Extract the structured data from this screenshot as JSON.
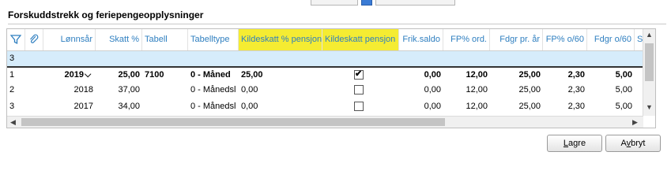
{
  "section": {
    "title": "Forskuddstrekk og feriepengeopplysninger"
  },
  "grid": {
    "columns": [
      {
        "key": "filter",
        "label": "",
        "icon": "filter-icon"
      },
      {
        "key": "attach",
        "label": "",
        "icon": "paperclip-icon"
      },
      {
        "key": "lonnsar",
        "label": "Lønnsår"
      },
      {
        "key": "skatt",
        "label": "Skatt %"
      },
      {
        "key": "tabell",
        "label": "Tabell"
      },
      {
        "key": "tabelltype",
        "label": "Tabelltype"
      },
      {
        "key": "kildeskatt_pct",
        "label": "Kildeskatt  % pensjon",
        "highlight": true
      },
      {
        "key": "kildeskatt",
        "label": "Kildeskatt pensjon",
        "highlight": true
      },
      {
        "key": "frik",
        "label": "Frik.saldo"
      },
      {
        "key": "fp_ord",
        "label": "FP% ord."
      },
      {
        "key": "fdgr_ar",
        "label": "Fdgr pr. år"
      },
      {
        "key": "fp_o60",
        "label": "FP% o/60"
      },
      {
        "key": "fdgr_o60",
        "label": "Fdgr o/60"
      },
      {
        "key": "s",
        "label": "S"
      }
    ],
    "rows": [
      {
        "num": "3",
        "new": true
      },
      {
        "num": "1",
        "lonnsar": "2019",
        "skatt": "25,00",
        "tabell": "7100",
        "tabelltype": "0 - Måned",
        "kildeskatt_pct": "25,00",
        "checked": true,
        "frik": "0,00",
        "fp_ord": "12,00",
        "fdgr_ar": "25,00",
        "fp_o60": "2,30",
        "fdgr_o60": "5,00",
        "bold": true
      },
      {
        "num": "2",
        "lonnsar": "2018",
        "skatt": "37,00",
        "tabell": "",
        "tabelltype": "0 - Månedsl",
        "kildeskatt_pct": "0,00",
        "checked": false,
        "frik": "0,00",
        "fp_ord": "12,00",
        "fdgr_ar": "25,00",
        "fp_o60": "2,30",
        "fdgr_o60": "5,00"
      },
      {
        "num": "3",
        "lonnsar": "2017",
        "skatt": "34,00",
        "tabell": "",
        "tabelltype": "0 - Månedsl",
        "kildeskatt_pct": "0,00",
        "checked": false,
        "frik": "0,00",
        "fp_ord": "12,00",
        "fdgr_ar": "25,00",
        "fp_o60": "2,30",
        "fdgr_o60": "5,00"
      }
    ],
    "dropdown_glyph": "⌵",
    "highlight_color": "#f5ec32",
    "header_color": "#2f7fc0",
    "new_row_color": "#d6ecfb"
  },
  "buttons": {
    "save_mnemonic": "L",
    "save_rest": "agre",
    "cancel_first": "A",
    "cancel_mnemonic": "v",
    "cancel_rest": "bryt"
  }
}
